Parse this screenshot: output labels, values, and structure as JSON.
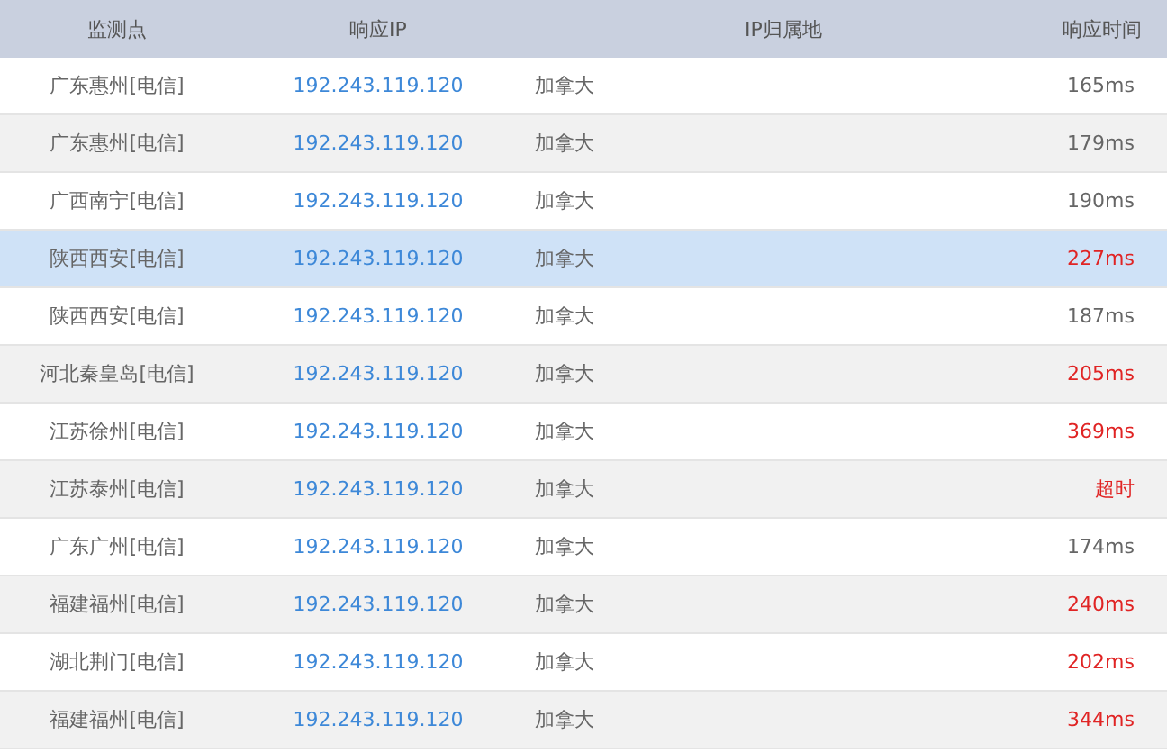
{
  "table": {
    "columns": [
      "监测点",
      "响应IP",
      "IP归属地",
      "响应时间"
    ],
    "rows": [
      {
        "node": "广东惠州[电信]",
        "ip": "192.243.119.120",
        "location": "加拿大",
        "time": "165ms",
        "slow": false,
        "selected": false
      },
      {
        "node": "广东惠州[电信]",
        "ip": "192.243.119.120",
        "location": "加拿大",
        "time": "179ms",
        "slow": false,
        "selected": false
      },
      {
        "node": "广西南宁[电信]",
        "ip": "192.243.119.120",
        "location": "加拿大",
        "time": "190ms",
        "slow": false,
        "selected": false
      },
      {
        "node": "陕西西安[电信]",
        "ip": "192.243.119.120",
        "location": "加拿大",
        "time": "227ms",
        "slow": true,
        "selected": true
      },
      {
        "node": "陕西西安[电信]",
        "ip": "192.243.119.120",
        "location": "加拿大",
        "time": "187ms",
        "slow": false,
        "selected": false
      },
      {
        "node": "河北秦皇岛[电信]",
        "ip": "192.243.119.120",
        "location": "加拿大",
        "time": "205ms",
        "slow": true,
        "selected": false
      },
      {
        "node": "江苏徐州[电信]",
        "ip": "192.243.119.120",
        "location": "加拿大",
        "time": "369ms",
        "slow": true,
        "selected": false
      },
      {
        "node": "江苏泰州[电信]",
        "ip": "192.243.119.120",
        "location": "加拿大",
        "time": "超时",
        "slow": true,
        "selected": false
      },
      {
        "node": "广东广州[电信]",
        "ip": "192.243.119.120",
        "location": "加拿大",
        "time": "174ms",
        "slow": false,
        "selected": false
      },
      {
        "node": "福建福州[电信]",
        "ip": "192.243.119.120",
        "location": "加拿大",
        "time": "240ms",
        "slow": true,
        "selected": false
      },
      {
        "node": "湖北荆门[电信]",
        "ip": "192.243.119.120",
        "location": "加拿大",
        "time": "202ms",
        "slow": true,
        "selected": false
      },
      {
        "node": "福建福州[电信]",
        "ip": "192.243.119.120",
        "location": "加拿大",
        "time": "344ms",
        "slow": true,
        "selected": false
      }
    ]
  }
}
